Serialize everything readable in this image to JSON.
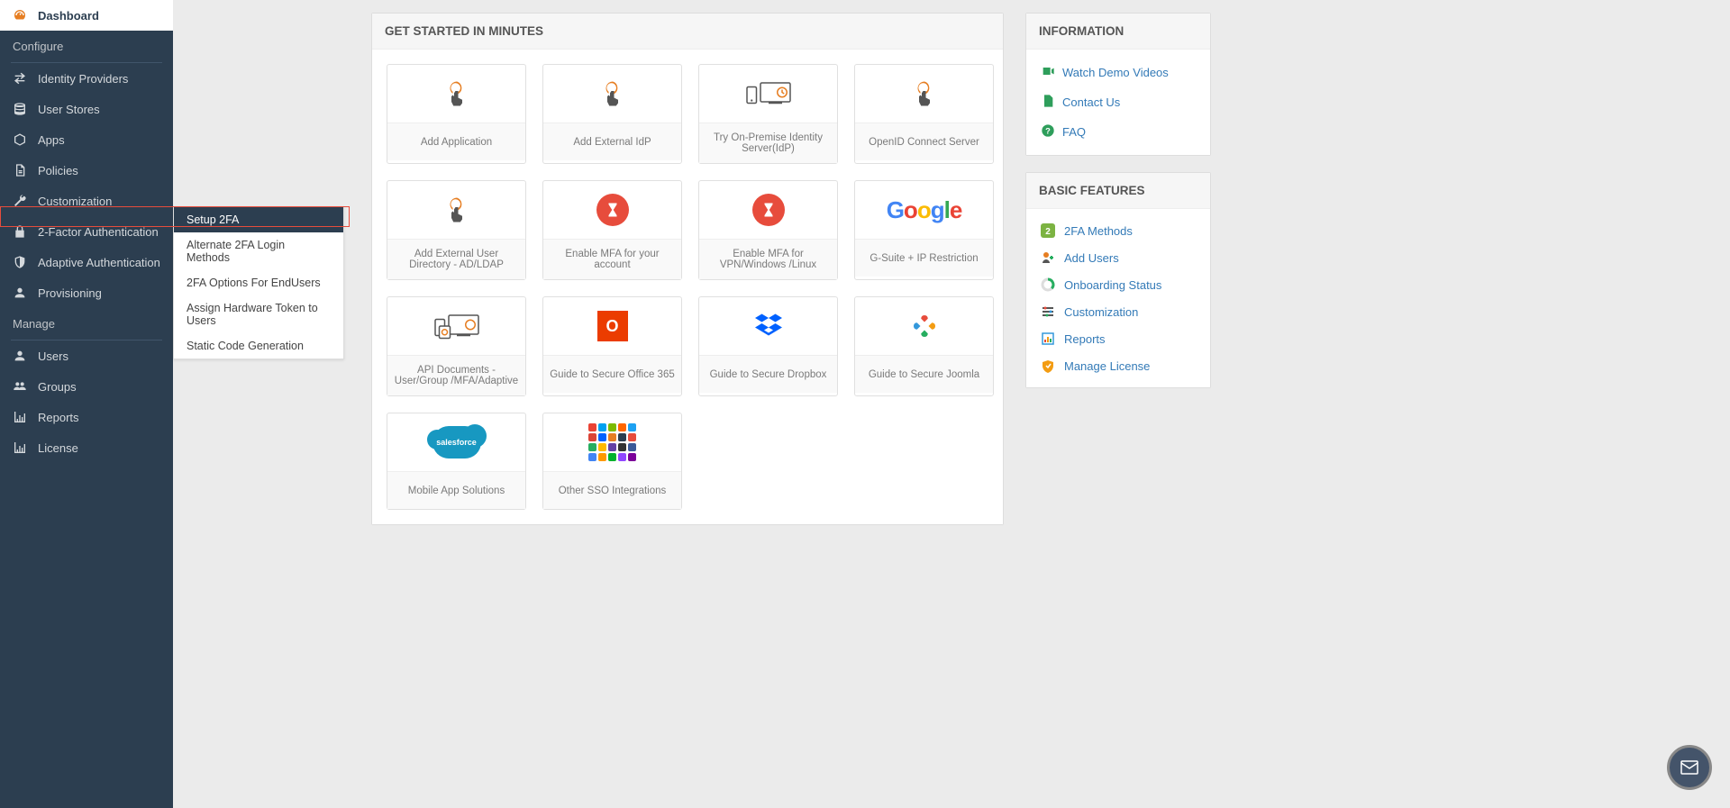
{
  "sidebar": {
    "items": [
      {
        "label": "Dashboard"
      },
      {
        "label": "Identity Providers"
      },
      {
        "label": "User Stores"
      },
      {
        "label": "Apps"
      },
      {
        "label": "Policies"
      },
      {
        "label": "Customization"
      },
      {
        "label": "2-Factor Authentication"
      },
      {
        "label": "Adaptive Authentication"
      },
      {
        "label": "Provisioning"
      },
      {
        "label": "Users"
      },
      {
        "label": "Groups"
      },
      {
        "label": "Reports"
      },
      {
        "label": "License"
      }
    ],
    "sections": {
      "configure": "Configure",
      "manage": "Manage"
    }
  },
  "submenu": {
    "items": [
      {
        "label": "Setup 2FA"
      },
      {
        "label": "Alternate 2FA Login Methods"
      },
      {
        "label": "2FA Options For EndUsers"
      },
      {
        "label": "Assign Hardware Token to Users"
      },
      {
        "label": "Static Code Generation"
      }
    ]
  },
  "getStarted": {
    "title": "GET STARTED IN MINUTES",
    "cards": [
      {
        "label": "Add Application"
      },
      {
        "label": "Add External IdP"
      },
      {
        "label": "Try On-Premise Identity Server(IdP)"
      },
      {
        "label": "OpenID Connect Server"
      },
      {
        "label": "Add External User Directory - AD/LDAP"
      },
      {
        "label": "Enable MFA for your account"
      },
      {
        "label": "Enable MFA for VPN/Windows /Linux"
      },
      {
        "label": "G-Suite + IP Restriction"
      },
      {
        "label": "API Documents - User/Group /MFA/Adaptive"
      },
      {
        "label": "Guide to Secure Office 365"
      },
      {
        "label": "Guide to Secure Dropbox"
      },
      {
        "label": "Guide to Secure Joomla"
      },
      {
        "label": "Mobile App Solutions"
      },
      {
        "label": "Other SSO Integrations"
      }
    ]
  },
  "information": {
    "title": "INFORMATION",
    "links": [
      {
        "label": "Watch Demo Videos"
      },
      {
        "label": "Contact Us"
      },
      {
        "label": "FAQ"
      }
    ]
  },
  "features": {
    "title": "BASIC FEATURES",
    "links": [
      {
        "label": "2FA Methods"
      },
      {
        "label": "Add Users"
      },
      {
        "label": "Onboarding Status"
      },
      {
        "label": "Customization"
      },
      {
        "label": "Reports"
      },
      {
        "label": "Manage License"
      }
    ]
  }
}
